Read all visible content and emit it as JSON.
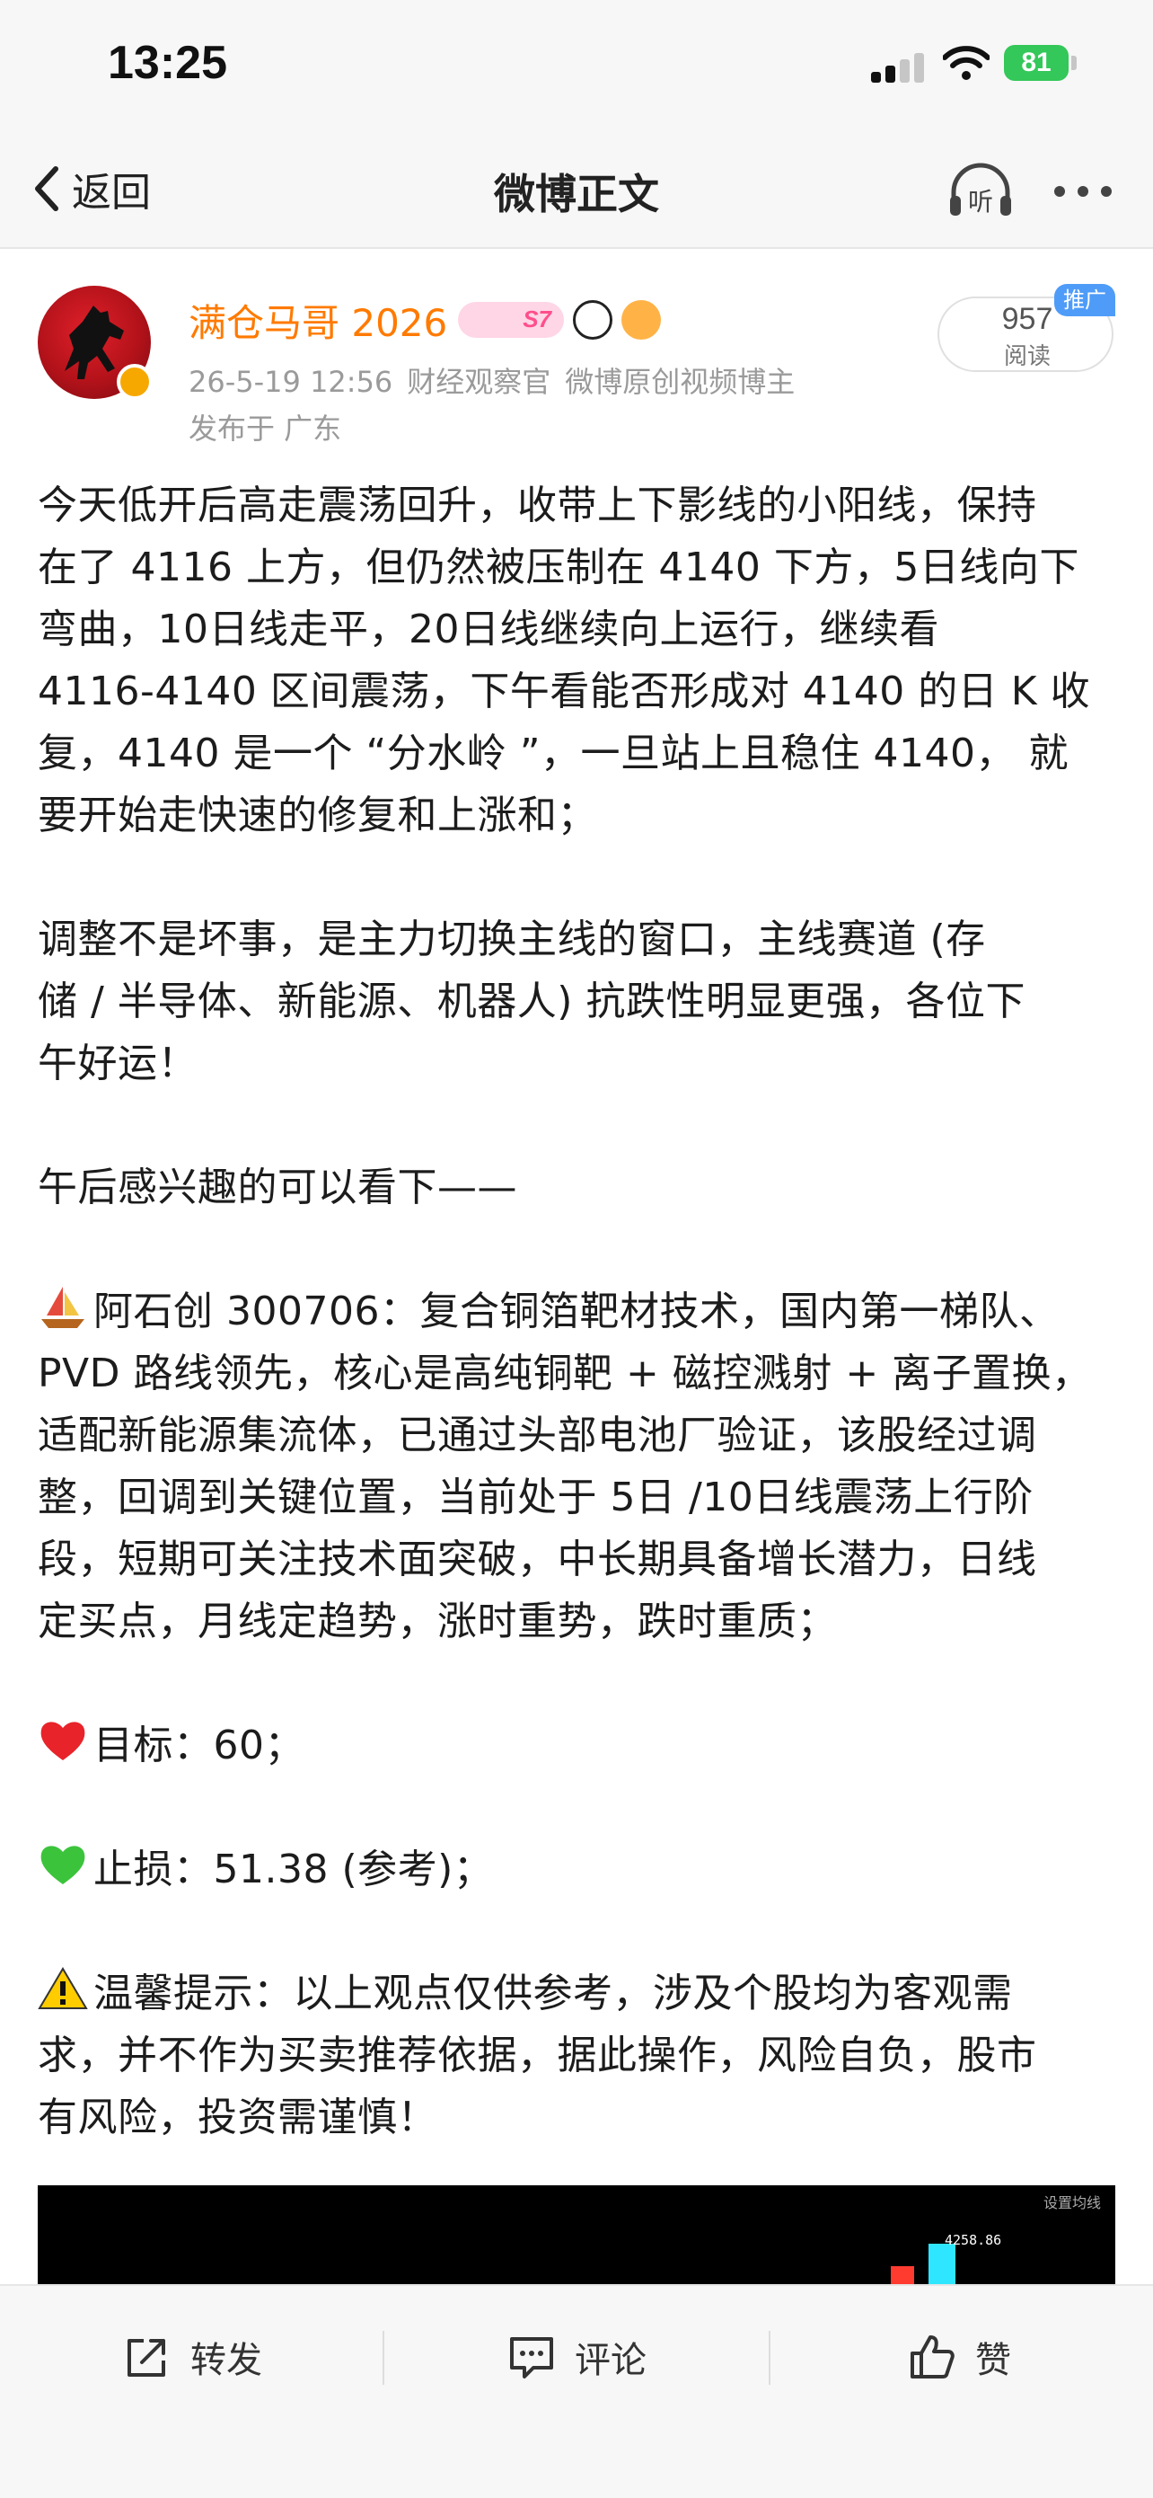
{
  "status_bar": {
    "time": "13:25",
    "battery": "81",
    "icons": [
      "signal-icon",
      "wifi-icon",
      "battery-icon"
    ]
  },
  "nav": {
    "back_label": "返回",
    "title": "微博正文",
    "listen_label": "听",
    "icons": [
      "chevron-left-icon",
      "headphones-icon",
      "more-icon"
    ]
  },
  "post": {
    "author": "满仓马哥 2026",
    "badge_level": "S7",
    "timestamp": "26-5-19 12:56",
    "source": "财经观察官",
    "author_tag": "微博原创视频博主",
    "location": "发布于 广东",
    "read_count": "957",
    "read_label": "阅读",
    "promo_tag": "推广",
    "lines": [
      "今天低开后高走震荡回升，收带上下影线的小阳线，保持",
      "在了 4116 上方，但仍然被压制在 4140 下方，5日线向下",
      "弯曲，10日线走平，20日线继续向上运行，继续看",
      " 4116-4140 区间震荡，下午看能否形成对 4140 的日 K 收",
      "复，4140 是一个 “分水岭 ”，一旦站上且稳住 4140， 就",
      "要开始走快速的修复和上涨和；",
      "",
      "调整不是坏事，是主力切换主线的窗口，主线赛道 (存",
      "储 / 半导体、新能源、机器人) 抗跌性明显更强，各位下",
      "午好运！",
      "",
      "午后感兴趣的可以看下——",
      "",
      "阿石创 300706：复合铜箔靶材技术，国内第一梯队、",
      "PVD 路线领先，核心是高纯铜靶 + 磁控溅射 + 离子置换，",
      "适配新能源集流体，已通过头部电池厂验证，该股经过调",
      "整，回调到关键位置，当前处于 5日 /10日线震荡上行阶",
      "段，短期可关注技术面突破，中长期具备增长潜力，日线",
      "定买点，月线定趋势，涨时重势，跌时重质；",
      "",
      "目标：60；",
      "",
      "止损：51.38 (参考)；",
      "",
      "温馨提示：以上观点仅供参考，涉及个股均为客观需",
      "求，并不作为买卖推荐依据，据此操作，风险自负，股市",
      "有风险，投资需谨慎！"
    ],
    "emojis": {
      "stock": "sailboat-icon",
      "target": "red-heart-icon",
      "stop": "green-heart-icon",
      "tip": "warning-icon"
    },
    "image_preview": {
      "hint": "设置均线",
      "price_label": "4258.86"
    }
  },
  "toolbar": {
    "repost": "转发",
    "comment": "评论",
    "like": "赞",
    "icons": [
      "share-icon",
      "comment-icon",
      "thumbs-up-icon"
    ]
  },
  "colors": {
    "username": "#ff7a00",
    "meta": "#9a9a9a",
    "promo": "#4f9cf8",
    "battery": "#34c759",
    "bar_bg": "#f7f7f7"
  }
}
